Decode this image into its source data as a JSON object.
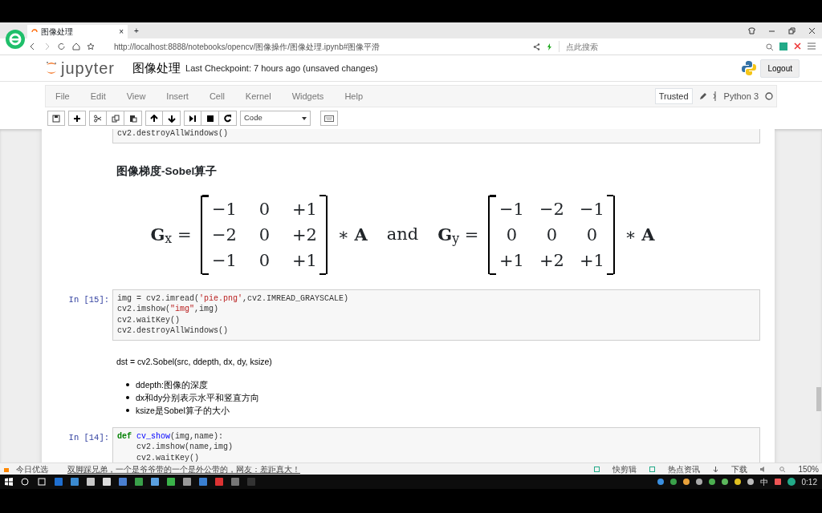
{
  "browser": {
    "tab_title": "图像处理",
    "tab_close": "×",
    "new_tab": "+",
    "url": "http://localhost:8888/notebooks/opencv/图像操作/图像处理.ipynb#图像平滑",
    "search_placeholder": "点此搜索"
  },
  "jupyter": {
    "logo": "jupyter",
    "notebook_name": "图像处理",
    "checkpoint": "Last Checkpoint: 7 hours ago (unsaved changes)",
    "logout": "Logout",
    "menu": [
      "File",
      "Edit",
      "View",
      "Insert",
      "Cell",
      "Kernel",
      "Widgets",
      "Help"
    ],
    "trusted": "Trusted",
    "kernel": "Python 3",
    "cell_type": "Code"
  },
  "cells": [
    {
      "kind": "code_tail",
      "lines": [
        [
          {
            "kind": "plain",
            "t": "cv2.destroyAllWindows()"
          }
        ]
      ]
    },
    {
      "kind": "heading",
      "text": "图像梯度-Sobel算子"
    },
    {
      "kind": "formula",
      "joiner": "and",
      "parts": [
        {
          "lhs": "**G**$_{x}$ =",
          "matrix": [
            [
              "−1",
              "0",
              "+1"
            ],
            [
              "−2",
              "0",
              "+2"
            ],
            [
              "−1",
              "0",
              "+1"
            ]
          ],
          "rhs": "∗ **A**"
        },
        {
          "lhs": "**G**$_{y}$ =",
          "matrix": [
            [
              "−1",
              "−2",
              "−1"
            ],
            [
              "0",
              "0",
              "0"
            ],
            [
              "+1",
              "+2",
              "+1"
            ]
          ],
          "rhs": "∗ **A**"
        }
      ]
    },
    {
      "kind": "code",
      "prompt": "In [15]:",
      "lines": [
        [
          {
            "kind": "plain",
            "t": "img = cv2.imread("
          },
          {
            "kind": "str",
            "t": "'pie.png'"
          },
          {
            "kind": "plain",
            "t": ",cv2.IMREAD_GRAYSCALE)"
          }
        ],
        [
          {
            "kind": "plain",
            "t": "cv2.imshow("
          },
          {
            "kind": "str",
            "t": "\"img\""
          },
          {
            "kind": "plain",
            "t": ",img)"
          }
        ],
        [
          {
            "kind": "plain",
            "t": "cv2.waitKey()"
          }
        ],
        [
          {
            "kind": "plain",
            "t": "cv2.destroyAllWindows()"
          }
        ]
      ]
    },
    {
      "kind": "markdown",
      "text": "dst = cv2.Sobel(src, ddepth, dx, dy, ksize)",
      "bullets": [
        "ddepth:图像的深度",
        "dx和dy分别表示水平和竖直方向",
        "ksize是Sobel算子的大小"
      ]
    },
    {
      "kind": "code",
      "prompt": "In [14]:",
      "lines": [
        [
          {
            "kind": "kw",
            "t": "def"
          },
          {
            "kind": "fn",
            "t": " cv_show"
          },
          {
            "kind": "plain",
            "t": "(img,name):"
          }
        ],
        [
          {
            "kind": "plain",
            "t": "    cv2.imshow(name,img)"
          }
        ],
        [
          {
            "kind": "plain",
            "t": "    cv2.waitKey()"
          }
        ]
      ]
    }
  ],
  "status_bar": {
    "left": "今日优选",
    "news": "双脚踩兄弟，一个是爷爷带的一个是外公带的，网友：差距真大！",
    "right": [
      "快剪辑",
      "热点资讯",
      "下载"
    ],
    "zoom": "150%"
  },
  "taskbar": {
    "ime": "中",
    "time": "0:12"
  }
}
